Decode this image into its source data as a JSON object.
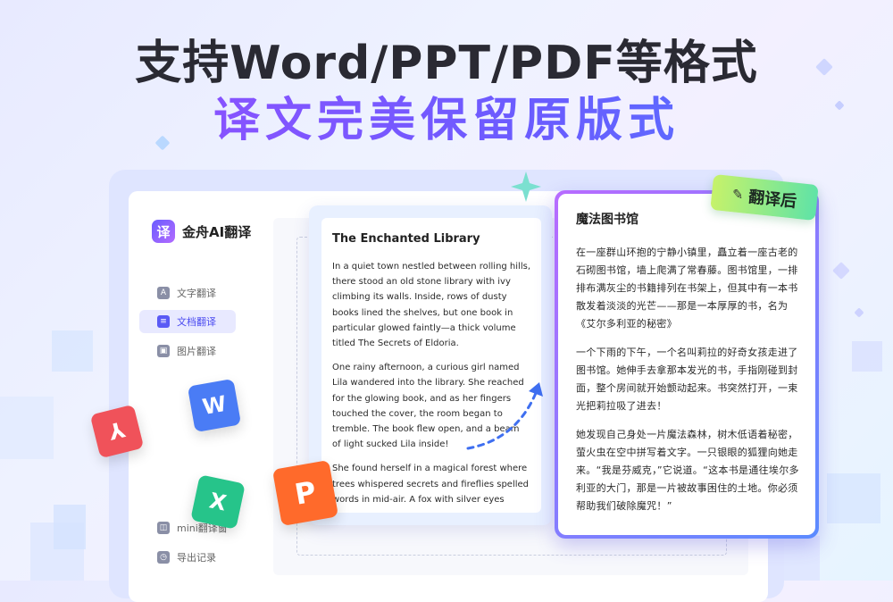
{
  "headline": {
    "line1": "支持Word/PPT/PDF等格式",
    "line2": "译文完美保留原版式"
  },
  "app": {
    "logo_mark": "译",
    "name": "金舟AI翻译"
  },
  "sidebar": {
    "items": [
      {
        "label": "文字翻译",
        "icon": "A"
      },
      {
        "label": "文档翻译",
        "icon": "≡"
      },
      {
        "label": "图片翻译",
        "icon": "▣"
      },
      {
        "label": "mini翻译窗",
        "icon": "◫"
      },
      {
        "label": "导出记录",
        "icon": "◷"
      }
    ]
  },
  "original_doc": {
    "title": "The Enchanted Library",
    "paragraphs": [
      "In a quiet town nestled between rolling hills, there stood an old stone library with ivy climbing its walls. Inside, rows of dusty books lined the shelves, but one book in particular glowed faintly—a thick volume titled The Secrets of Eldoria.",
      "One rainy afternoon, a curious girl named Lila wandered into the library. She reached for the glowing book, and as her fingers touched the cover, the room began to tremble. The book flew open, and a beam of light sucked Lila inside!",
      "She found herself in a magical forest where trees whispered secrets and fireflies spelled words in mid-air. A fox with silver eyes"
    ]
  },
  "translated_doc": {
    "title": "魔法图书馆",
    "paragraphs": [
      "在一座群山环抱的宁静小镇里，矗立着一座古老的石砌图书馆，墙上爬满了常春藤。图书馆里，一排排布满灰尘的书籍排列在书架上，但其中有一本书散发着淡淡的光芒——那是一本厚厚的书，名为《艾尔多利亚的秘密》",
      "一个下雨的下午，一个名叫莉拉的好奇女孩走进了图书馆。她伸手去拿那本发光的书，手指刚碰到封面，整个房间就开始颤动起来。书突然打开，一束光把莉拉吸了进去！",
      "她发现自己身处一片魔法森林，树木低语着秘密，萤火虫在空中拼写着文字。一只银眼的狐狸向她走来。“我是芬威克，”它说道。“这本书是通往埃尔多利亚的大门，那是一片被故事困住的土地。你必须帮助我们破除魔咒！”"
    ]
  },
  "badge": {
    "label": "翻译后",
    "icon": "magic-wand-icon"
  },
  "file_icons": {
    "pdf": {
      "glyph": "⅄",
      "color": "#f0525a"
    },
    "word": {
      "glyph": "W",
      "color": "#4a7cf5"
    },
    "excel": {
      "glyph": "X",
      "color": "#26c48a"
    },
    "ppt": {
      "glyph": "P",
      "color": "#ff6a2b"
    }
  },
  "colors": {
    "accent": "#5a5af5",
    "gradient_start": "#b86bff",
    "gradient_end": "#5b8bff"
  }
}
